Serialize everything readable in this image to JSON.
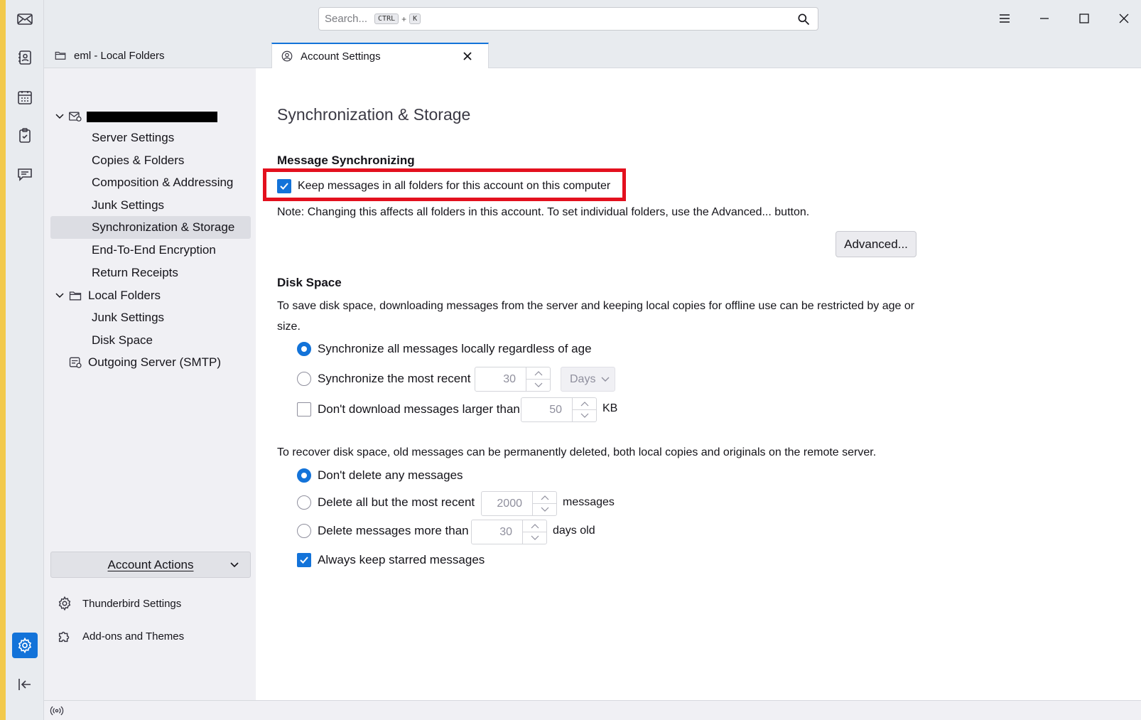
{
  "window": {
    "search_placeholder": "Search...",
    "search_shortcut_key1": "CTRL",
    "search_shortcut_plus": "+",
    "search_shortcut_key2": "K"
  },
  "tabs": [
    {
      "label": "eml - Local Folders",
      "icon": "folder-icon",
      "selected": false
    },
    {
      "label": "Account Settings",
      "icon": "account-settings-icon",
      "selected": true
    }
  ],
  "sidebar": {
    "account_items": [
      {
        "label": "Server Settings"
      },
      {
        "label": "Copies & Folders"
      },
      {
        "label": "Composition & Addressing"
      },
      {
        "label": "Junk Settings"
      },
      {
        "label": "Synchronization & Storage",
        "selected": true
      },
      {
        "label": "End-To-End Encryption"
      },
      {
        "label": "Return Receipts"
      }
    ],
    "local_folders_label": "Local Folders",
    "local_items": [
      {
        "label": "Junk Settings"
      },
      {
        "label": "Disk Space"
      }
    ],
    "outgoing_label": "Outgoing Server (SMTP)",
    "account_actions_label": "Account Actions",
    "thunderbird_settings_label": "Thunderbird Settings",
    "addons_label": "Add-ons and Themes"
  },
  "content": {
    "page_title": "Synchronization & Storage",
    "msg_sync_heading": "Message Synchronizing",
    "keep_messages_label": "Keep messages in all folders for this account on this computer",
    "keep_messages_checked": true,
    "note": "Note: Changing this affects all folders in this account. To set individual folders, use the Advanced... button.",
    "advanced_button": "Advanced...",
    "disk_space_heading": "Disk Space",
    "disk_intro_1": "To save disk space, downloading messages from the server and keeping local copies for offline use can be restricted by age or",
    "disk_intro_2": "size.",
    "sync_all_label": "Synchronize all messages locally regardless of age",
    "sync_recent_label": "Synchronize the most recent",
    "sync_recent_value": "30",
    "sync_recent_unit": "Days",
    "dont_download_label": "Don't download messages larger than",
    "dont_download_value": "50",
    "dont_download_unit": "KB",
    "recover_intro": "To recover disk space, old messages can be permanently deleted, both local copies and originals on the remote server.",
    "dont_delete_label": "Don't delete any messages",
    "delete_all_but_label": "Delete all but the most recent",
    "delete_all_but_value": "2000",
    "delete_all_but_unit": "messages",
    "delete_older_label": "Delete messages more than",
    "delete_older_value": "30",
    "delete_older_unit": "days old",
    "keep_starred_label": "Always keep starred messages",
    "keep_starred_checked": true
  },
  "colors": {
    "accent": "#1373d9",
    "highlight_box": "#e3101e"
  }
}
